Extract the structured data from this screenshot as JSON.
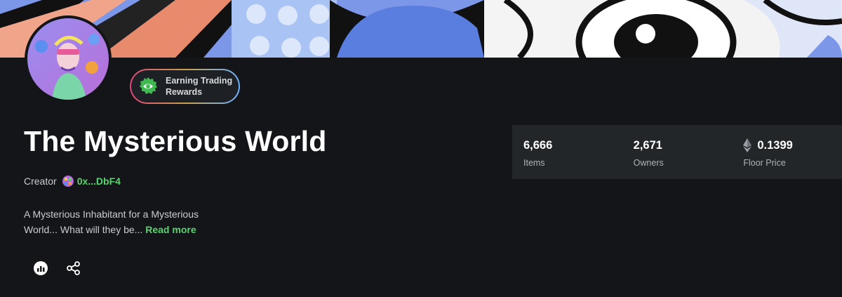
{
  "collection": {
    "title": "The Mysterious World",
    "creator_label": "Creator",
    "creator_address": "0x...DbF4",
    "description": "A Mysterious Inhabitant for a Mysterious World... What will they be...",
    "read_more": "Read more"
  },
  "badge": {
    "text": "Earning Trading Rewards",
    "icon": "eye-badge-icon"
  },
  "stats": [
    {
      "value": "6,666",
      "label": "Items"
    },
    {
      "value": "2,671",
      "label": "Owners"
    },
    {
      "value": "0.1399",
      "label": "Floor Price",
      "icon": "ethereum-icon"
    }
  ],
  "actions": {
    "stats_icon": "chart-icon",
    "share_icon": "share-icon"
  },
  "colors": {
    "accent_green": "#5bd36f",
    "background": "#131518",
    "panel": "#222629"
  }
}
